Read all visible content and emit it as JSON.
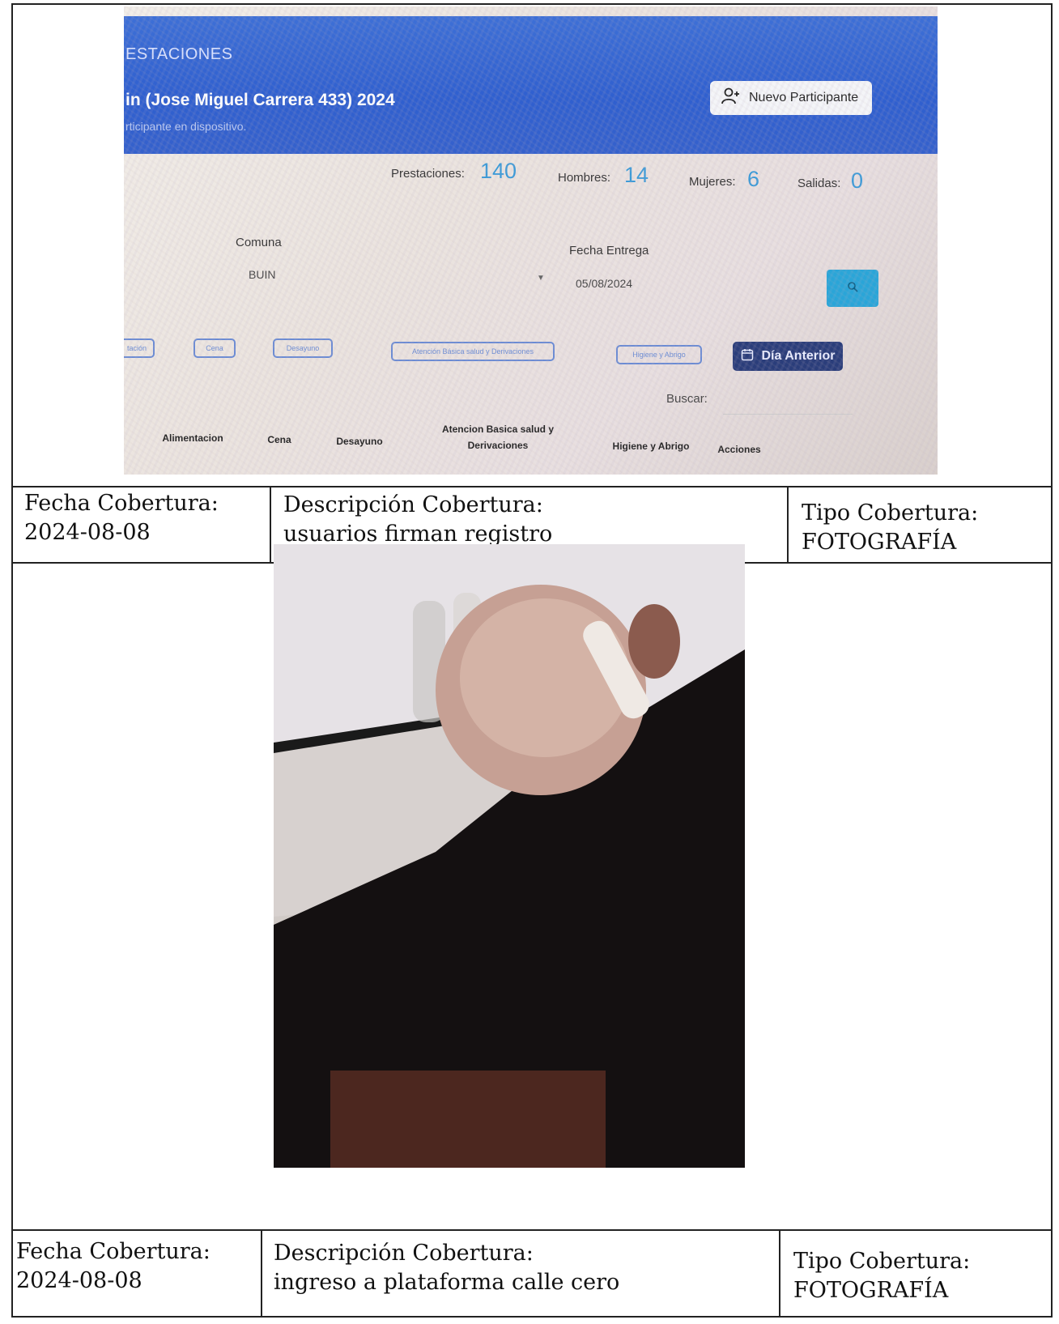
{
  "screenshot": {
    "header_title": "ESTACIONES",
    "header_name": "in (Jose Miguel Carrera 433) 2024",
    "header_subtitle": "rticipante en dispositivo.",
    "new_participant_button": "Nuevo Participante",
    "stats": [
      {
        "label": "Prestaciones:",
        "value": "140"
      },
      {
        "label": "Hombres:",
        "value": "14"
      },
      {
        "label": "Mujeres:",
        "value": "6"
      },
      {
        "label": "Salidas:",
        "value": "0"
      }
    ],
    "comuna_label": "Comuna",
    "comuna_value": "BUIN",
    "fecha_label": "Fecha Entrega",
    "fecha_value": "05/08/2024",
    "filter_buttons": [
      "tación",
      "Cena",
      "Desayuno",
      "Atención Básica salud y Derivaciones",
      "Higiene y Abrigo"
    ],
    "prev_day_button": "Día Anterior",
    "search_label": "Buscar:",
    "table_headers": [
      "Alimentacion",
      "Cena",
      "Desayuno",
      "Atencion Basica salud y Derivaciones",
      "Higiene y Abrigo",
      "Acciones"
    ]
  },
  "rows": [
    {
      "fecha_label": "Fecha Cobertura:",
      "fecha_value": "2024-08-08",
      "desc_label": "Descripción Cobertura:",
      "desc_value": "usuarios firman registro",
      "tipo_label": "Tipo Cobertura:",
      "tipo_value": "FOTOGRAFÍA"
    },
    {
      "fecha_label": "Fecha Cobertura:",
      "fecha_value": "2024-08-08",
      "desc_label": "Descripción Cobertura:",
      "desc_value": "ingreso a plataforma calle cero",
      "tipo_label": "Tipo Cobertura:",
      "tipo_value": "FOTOGRAFÍA"
    }
  ],
  "colors": {
    "header_blue": "#2f5fcf",
    "stat_value": "#3a9ad8",
    "search_button": "#2aa5d8",
    "prev_day_button": "#2a3d7a"
  }
}
